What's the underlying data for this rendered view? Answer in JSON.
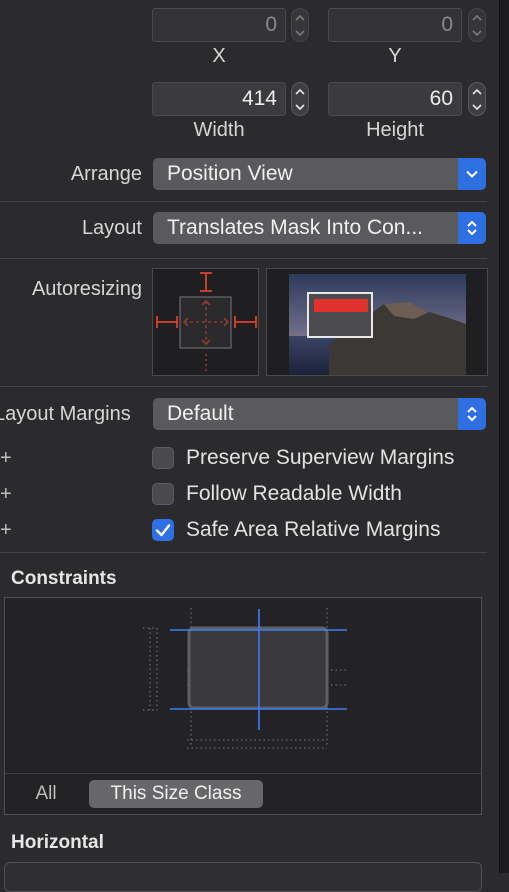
{
  "position": {
    "x_value": "0",
    "y_value": "0",
    "x_label": "X",
    "y_label": "Y"
  },
  "size": {
    "width_value": "414",
    "height_value": "60",
    "width_label": "Width",
    "height_label": "Height"
  },
  "arrange": {
    "label": "Arrange",
    "value": "Position View"
  },
  "layout": {
    "label": "Layout",
    "value": "Translates Mask Into Con..."
  },
  "autoresizing": {
    "label": "Autoresizing"
  },
  "layout_margins": {
    "label": "Layout Margins",
    "value": "Default",
    "options": [
      {
        "label": "Preserve Superview Margins",
        "checked": false
      },
      {
        "label": "Follow Readable Width",
        "checked": false
      },
      {
        "label": "Safe Area Relative Margins",
        "checked": true
      }
    ]
  },
  "constraints": {
    "title": "Constraints",
    "segments": [
      "All",
      "This Size Class"
    ],
    "selected_segment": "This Size Class"
  },
  "horizontal": {
    "title": "Horizontal"
  },
  "colors": {
    "accent": "#2f6fe4",
    "spring": "#d9402f",
    "panel": "#2b2b2d"
  }
}
